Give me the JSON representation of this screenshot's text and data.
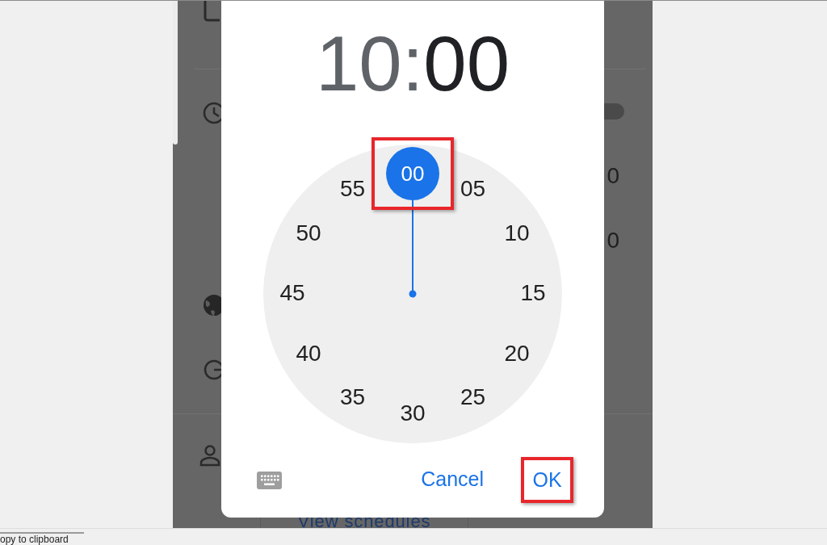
{
  "background_screen": {
    "switch": {
      "on": false
    },
    "values": [
      "0",
      "0"
    ],
    "button": "View schedules"
  },
  "time_picker": {
    "hour": {
      "text": "10",
      "selected": false
    },
    "separator": ":",
    "minute": {
      "text": "00",
      "selected": true
    },
    "dial": [
      {
        "label": "00",
        "selected": true,
        "highlighted": true
      },
      {
        "label": "05",
        "selected": false,
        "highlighted": false
      },
      {
        "label": "10",
        "selected": false,
        "highlighted": false
      },
      {
        "label": "15",
        "selected": false,
        "highlighted": false
      },
      {
        "label": "20",
        "selected": false,
        "highlighted": false
      },
      {
        "label": "25",
        "selected": false,
        "highlighted": false
      },
      {
        "label": "30",
        "selected": false,
        "highlighted": false
      },
      {
        "label": "35",
        "selected": false,
        "highlighted": false
      },
      {
        "label": "40",
        "selected": false,
        "highlighted": false
      },
      {
        "label": "45",
        "selected": false,
        "highlighted": false
      },
      {
        "label": "50",
        "selected": false,
        "highlighted": false
      },
      {
        "label": "55",
        "selected": false,
        "highlighted": false
      }
    ],
    "buttons": [
      {
        "label": "Cancel",
        "highlighted": false
      },
      {
        "label": "OK",
        "highlighted": true
      }
    ]
  },
  "status_bar": {
    "tab": "opy to clipboard"
  }
}
